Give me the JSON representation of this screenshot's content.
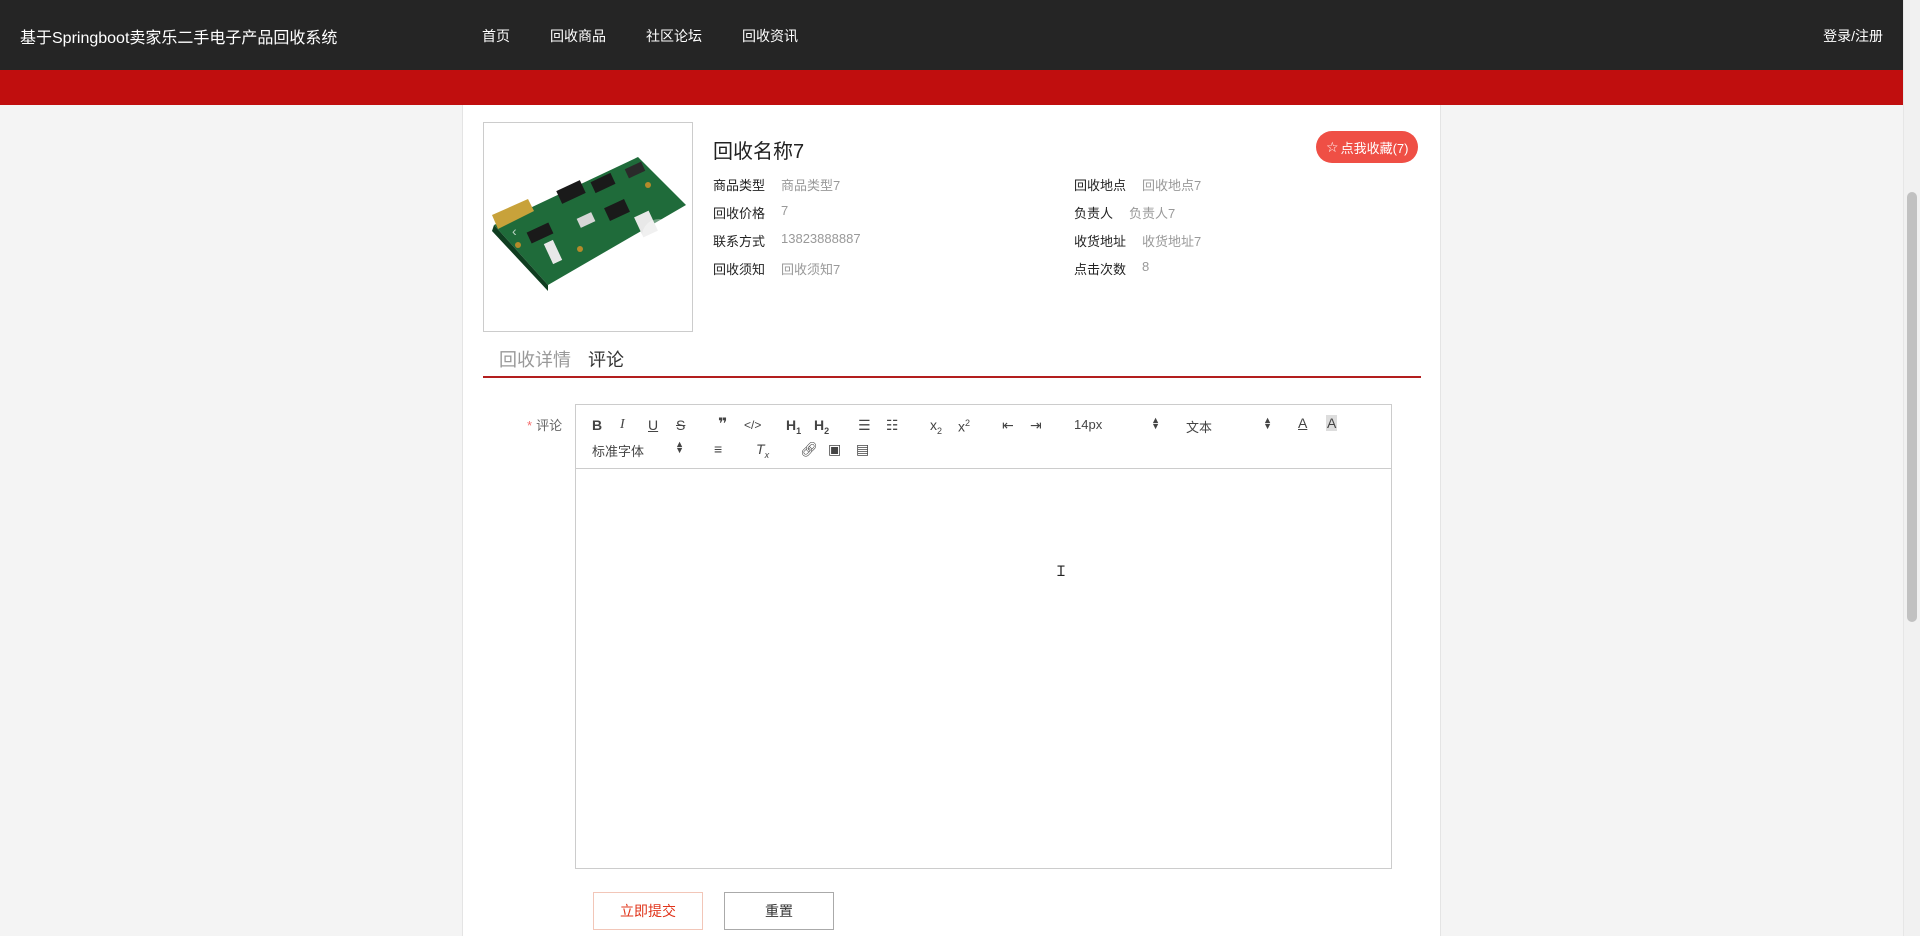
{
  "header": {
    "site_title": "基于Springboot卖家乐二手电子产品回收系统",
    "nav": [
      "首页",
      "回收商品",
      "社区论坛",
      "回收资讯"
    ],
    "login": "登录/注册"
  },
  "product": {
    "name": "回收名称7",
    "favorite_button": "点我收藏(7)",
    "info_left": [
      {
        "label": "商品类型",
        "value": "商品类型7"
      },
      {
        "label": "回收价格",
        "value": "7"
      },
      {
        "label": "联系方式",
        "value": "13823888887"
      },
      {
        "label": "回收须知",
        "value": "回收须知7"
      }
    ],
    "info_right": [
      {
        "label": "回收地点",
        "value": "回收地点7"
      },
      {
        "label": "负责人",
        "value": "负责人7"
      },
      {
        "label": "收货地址",
        "value": "收货地址7"
      },
      {
        "label": "点击次数",
        "value": "8"
      }
    ]
  },
  "tabs": {
    "detail": "回收详情",
    "comment": "评论"
  },
  "form": {
    "required_mark": "*",
    "comment_label": "评论",
    "font_size_select": "14px",
    "header_select": "文本",
    "font_family_select": "标准字体",
    "submit": "立即提交",
    "reset": "重置"
  },
  "colors": {
    "topbar": "#252525",
    "accent_red": "#c00e0e",
    "favorite": "#ef4f45"
  }
}
